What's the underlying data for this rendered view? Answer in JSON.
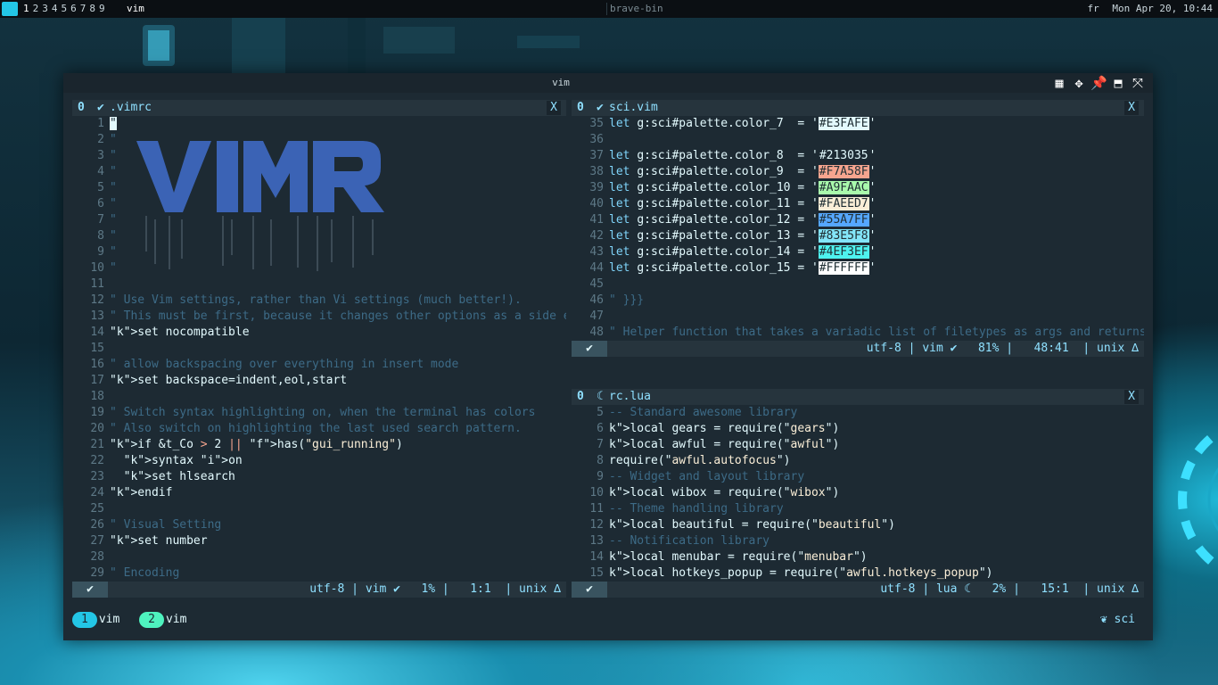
{
  "topbar": {
    "tags": [
      "1",
      "2",
      "3",
      "4",
      "5",
      "6",
      "7",
      "8",
      "9"
    ],
    "layout": "vim",
    "center_title": "brave-bin",
    "lang": "fr",
    "datetime": "Mon Apr 20, 10:44"
  },
  "window": {
    "title": "vim",
    "buttons": [
      "grid-icon",
      "move-icon",
      "pin-icon",
      "maximize-icon",
      "fullscreen-icon"
    ]
  },
  "panes": {
    "left": {
      "num": "0",
      "icon": "check-icon",
      "filename": ".vimrc",
      "close": "X",
      "lines": [
        {
          "n": "1",
          "t": "\""
        },
        {
          "n": "2",
          "t": "\""
        },
        {
          "n": "3",
          "t": "\""
        },
        {
          "n": "4",
          "t": "\""
        },
        {
          "n": "5",
          "t": "\""
        },
        {
          "n": "6",
          "t": "\""
        },
        {
          "n": "7",
          "t": "\""
        },
        {
          "n": "8",
          "t": "\""
        },
        {
          "n": "9",
          "t": "\""
        },
        {
          "n": "10",
          "t": "\""
        },
        {
          "n": "11",
          "t": ""
        },
        {
          "n": "12",
          "t": "\" Use Vim settings, rather than Vi settings (much better!)."
        },
        {
          "n": "13",
          "t": "\" This must be first, because it changes other options as a side effect."
        },
        {
          "n": "14",
          "t": "set nocompatible"
        },
        {
          "n": "15",
          "t": ""
        },
        {
          "n": "16",
          "t": "\" allow backspacing over everything in insert mode"
        },
        {
          "n": "17",
          "t": "set backspace=indent,eol,start"
        },
        {
          "n": "18",
          "t": ""
        },
        {
          "n": "19",
          "t": "\" Switch syntax highlighting on, when the terminal has colors"
        },
        {
          "n": "20",
          "t": "\" Also switch on highlighting the last used search pattern."
        },
        {
          "n": "21",
          "t": "if &t_Co > 2 || has(\"gui_running\")"
        },
        {
          "n": "22",
          "t": "  syntax on"
        },
        {
          "n": "23",
          "t": "  set hlsearch"
        },
        {
          "n": "24",
          "t": "endif"
        },
        {
          "n": "25",
          "t": ""
        },
        {
          "n": "26",
          "t": "\" Visual Setting"
        },
        {
          "n": "27",
          "t": "set number"
        },
        {
          "n": "28",
          "t": ""
        },
        {
          "n": "29",
          "t": "\" Encoding"
        }
      ],
      "status": {
        "enc": "utf-8",
        "ft": "vim",
        "pct": "1%",
        "pos": "1:1",
        "fmt": "unix"
      }
    },
    "top_right": {
      "num": "0",
      "filename": "sci.vim",
      "close": "X",
      "lines": [
        {
          "n": "35",
          "name": "color_7",
          "hex": "#E3FAFE",
          "bg": "#e3fafe"
        },
        {
          "n": "36"
        },
        {
          "n": "37",
          "name": "color_8",
          "hex": "#213035",
          "bg": "none"
        },
        {
          "n": "38",
          "name": "color_9",
          "hex": "#F7A58F",
          "bg": "#f7a58f"
        },
        {
          "n": "39",
          "name": "color_10",
          "hex": "#A9FAAC",
          "bg": "#a9faac"
        },
        {
          "n": "40",
          "name": "color_11",
          "hex": "#FAEED7",
          "bg": "#faeed7"
        },
        {
          "n": "41",
          "name": "color_12",
          "hex": "#55A7FF",
          "bg": "#55a7ff"
        },
        {
          "n": "42",
          "name": "color_13",
          "hex": "#83E5F8",
          "bg": "#83e5f8"
        },
        {
          "n": "43",
          "name": "color_14",
          "hex": "#4EF3EF",
          "bg": "#4ef3ef"
        },
        {
          "n": "44",
          "name": "color_15",
          "hex": "#FFFFFF",
          "bg": "#ffffff"
        },
        {
          "n": "45"
        },
        {
          "n": "46",
          "comment": "\" }}}"
        },
        {
          "n": "47"
        },
        {
          "n": "48",
          "comment": "\" Helper function that takes a variadic list of filetypes as args and returns"
        }
      ],
      "let_prefix": "let ",
      "var_prefix": "g:sci#palette.",
      "status": {
        "enc": "utf-8",
        "ft": "vim",
        "pct": "81%",
        "pos": "48:41",
        "fmt": "unix"
      }
    },
    "bottom_right": {
      "num": "0",
      "filename": "rc.lua",
      "close": "X",
      "lines": [
        {
          "n": "5",
          "t": "-- Standard awesome library"
        },
        {
          "n": "6",
          "t": "local gears = require(\"gears\")"
        },
        {
          "n": "7",
          "t": "local awful = require(\"awful\")"
        },
        {
          "n": "8",
          "t": "require(\"awful.autofocus\")"
        },
        {
          "n": "9",
          "t": "-- Widget and layout library"
        },
        {
          "n": "10",
          "t": "local wibox = require(\"wibox\")"
        },
        {
          "n": "11",
          "t": "-- Theme handling library"
        },
        {
          "n": "12",
          "t": "local beautiful = require(\"beautiful\")"
        },
        {
          "n": "13",
          "t": "-- Notification library"
        },
        {
          "n": "14",
          "t": "local menubar = require(\"menubar\")"
        },
        {
          "n": "15",
          "t": "local hotkeys_popup = require(\"awful.hotkeys_popup\")"
        }
      ],
      "status": {
        "enc": "utf-8",
        "ft": "lua",
        "pct": "2%",
        "pos": "15:1",
        "fmt": "unix"
      }
    }
  },
  "tmux": {
    "windows": [
      {
        "index": "1",
        "name": "vim",
        "color": "#23c6e6"
      },
      {
        "index": "2",
        "name": "vim",
        "color": "#4ef3bf"
      }
    ],
    "session": "sci"
  },
  "colors": {
    "accent": "#8fe0ff",
    "comment": "#3d6b87",
    "keyword": "#7fd3f8",
    "string": "#faeed7",
    "art": "#3b63b5"
  }
}
